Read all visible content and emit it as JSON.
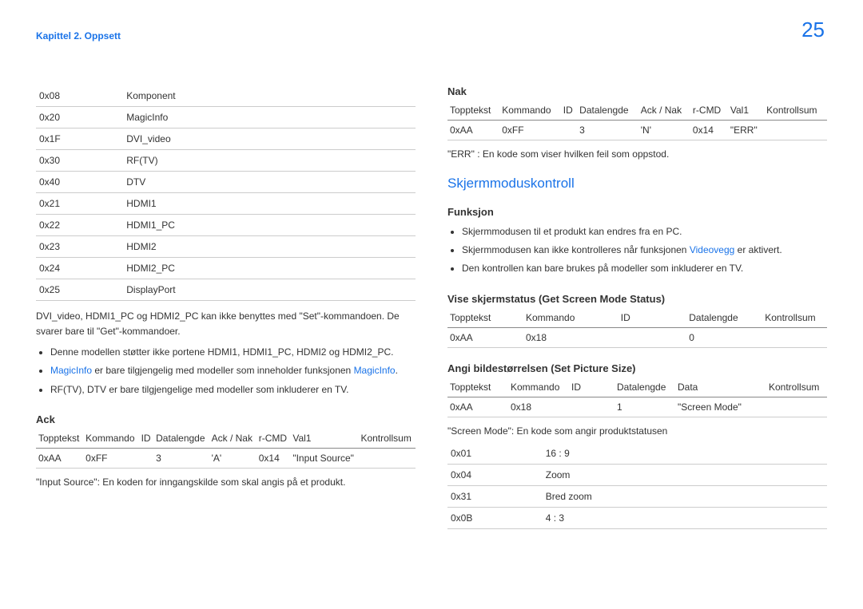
{
  "header": {
    "chapter": "Kapittel 2. Oppsett",
    "page": "25"
  },
  "left": {
    "codes": [
      {
        "code": "0x08",
        "label": "Komponent"
      },
      {
        "code": "0x20",
        "label": "MagicInfo"
      },
      {
        "code": "0x1F",
        "label": "DVI_video"
      },
      {
        "code": "0x30",
        "label": "RF(TV)"
      },
      {
        "code": "0x40",
        "label": "DTV"
      },
      {
        "code": "0x21",
        "label": "HDMI1"
      },
      {
        "code": "0x22",
        "label": "HDMI1_PC"
      },
      {
        "code": "0x23",
        "label": "HDMI2"
      },
      {
        "code": "0x24",
        "label": "HDMI2_PC"
      },
      {
        "code": "0x25",
        "label": "DisplayPort"
      }
    ],
    "para1": "DVI_video, HDMI1_PC og HDMI2_PC kan ikke benyttes med \"Set\"-kommandoen. De svarer bare til \"Get\"-kommandoer.",
    "bullet1": "Denne modellen støtter ikke portene HDMI1, HDMI1_PC, HDMI2 og HDMI2_PC.",
    "bullet2_pre": "MagicInfo",
    "bullet2_mid": " er bare tilgjengelig med modeller som inneholder funksjonen ",
    "bullet2_suf": "MagicInfo",
    "bullet2_end": ".",
    "bullet3": "RF(TV), DTV er bare tilgjengelige med modeller som inkluderer en TV.",
    "ack_title": "Ack",
    "ack_headers": {
      "h1": "Topptekst",
      "h2": "Kommando",
      "h3": "ID",
      "h4": "Datalengde",
      "h5": "Ack / Nak",
      "h6": "r-CMD",
      "h7": "Val1",
      "h8": "Kontrollsum"
    },
    "ack_row": {
      "c1": "0xAA",
      "c2": "0xFF",
      "c3": "",
      "c4": "3",
      "c5": "'A'",
      "c6": "0x14",
      "c7": "\"Input Source\"",
      "c8": ""
    },
    "note1": "\"Input Source\": En koden for inngangskilde som skal angis på et produkt."
  },
  "right": {
    "nak_title": "Nak",
    "nak_headers": {
      "h1": "Topptekst",
      "h2": "Kommando",
      "h3": "ID",
      "h4": "Datalengde",
      "h5": "Ack / Nak",
      "h6": "r-CMD",
      "h7": "Val1",
      "h8": "Kontrollsum"
    },
    "nak_row": {
      "c1": "0xAA",
      "c2": "0xFF",
      "c3": "",
      "c4": "3",
      "c5": "'N'",
      "c6": "0x14",
      "c7": "\"ERR\"",
      "c8": ""
    },
    "note_err": "\"ERR\" : En kode som viser hvilken feil som oppstod.",
    "section_title": "Skjermmoduskontroll",
    "funksjon_title": "Funksjon",
    "f_bullet1": "Skjermmodusen til et produkt kan endres fra en PC.",
    "f_bullet2_pre": "Skjermmodusen kan ikke kontrolleres når funksjonen ",
    "f_bullet2_link": "Videovegg",
    "f_bullet2_suf": " er aktivert.",
    "f_bullet3": "Den kontrollen kan bare brukes på modeller som inkluderer en TV.",
    "vise_title": "Vise skjermstatus (Get Screen Mode Status)",
    "vise_headers": {
      "h1": "Topptekst",
      "h2": "Kommando",
      "h3": "ID",
      "h4": "Datalengde",
      "h5": "Kontrollsum"
    },
    "vise_row": {
      "c1": "0xAA",
      "c2": "0x18",
      "c3": "",
      "c4": "0",
      "c5": ""
    },
    "angi_title": "Angi bildestørrelsen (Set Picture Size)",
    "angi_headers": {
      "h1": "Topptekst",
      "h2": "Kommando",
      "h3": "ID",
      "h4": "Datalengde",
      "h5": "Data",
      "h6": "Kontrollsum"
    },
    "angi_row": {
      "c1": "0xAA",
      "c2": "0x18",
      "c3": "",
      "c4": "1",
      "c5": "\"Screen Mode\"",
      "c6": ""
    },
    "note_screen": "\"Screen Mode\": En kode som angir produktstatusen",
    "modes": [
      {
        "code": "0x01",
        "label": "16 : 9"
      },
      {
        "code": "0x04",
        "label": "Zoom"
      },
      {
        "code": "0x31",
        "label": "Bred zoom"
      },
      {
        "code": "0x0B",
        "label": "4 : 3"
      }
    ]
  }
}
